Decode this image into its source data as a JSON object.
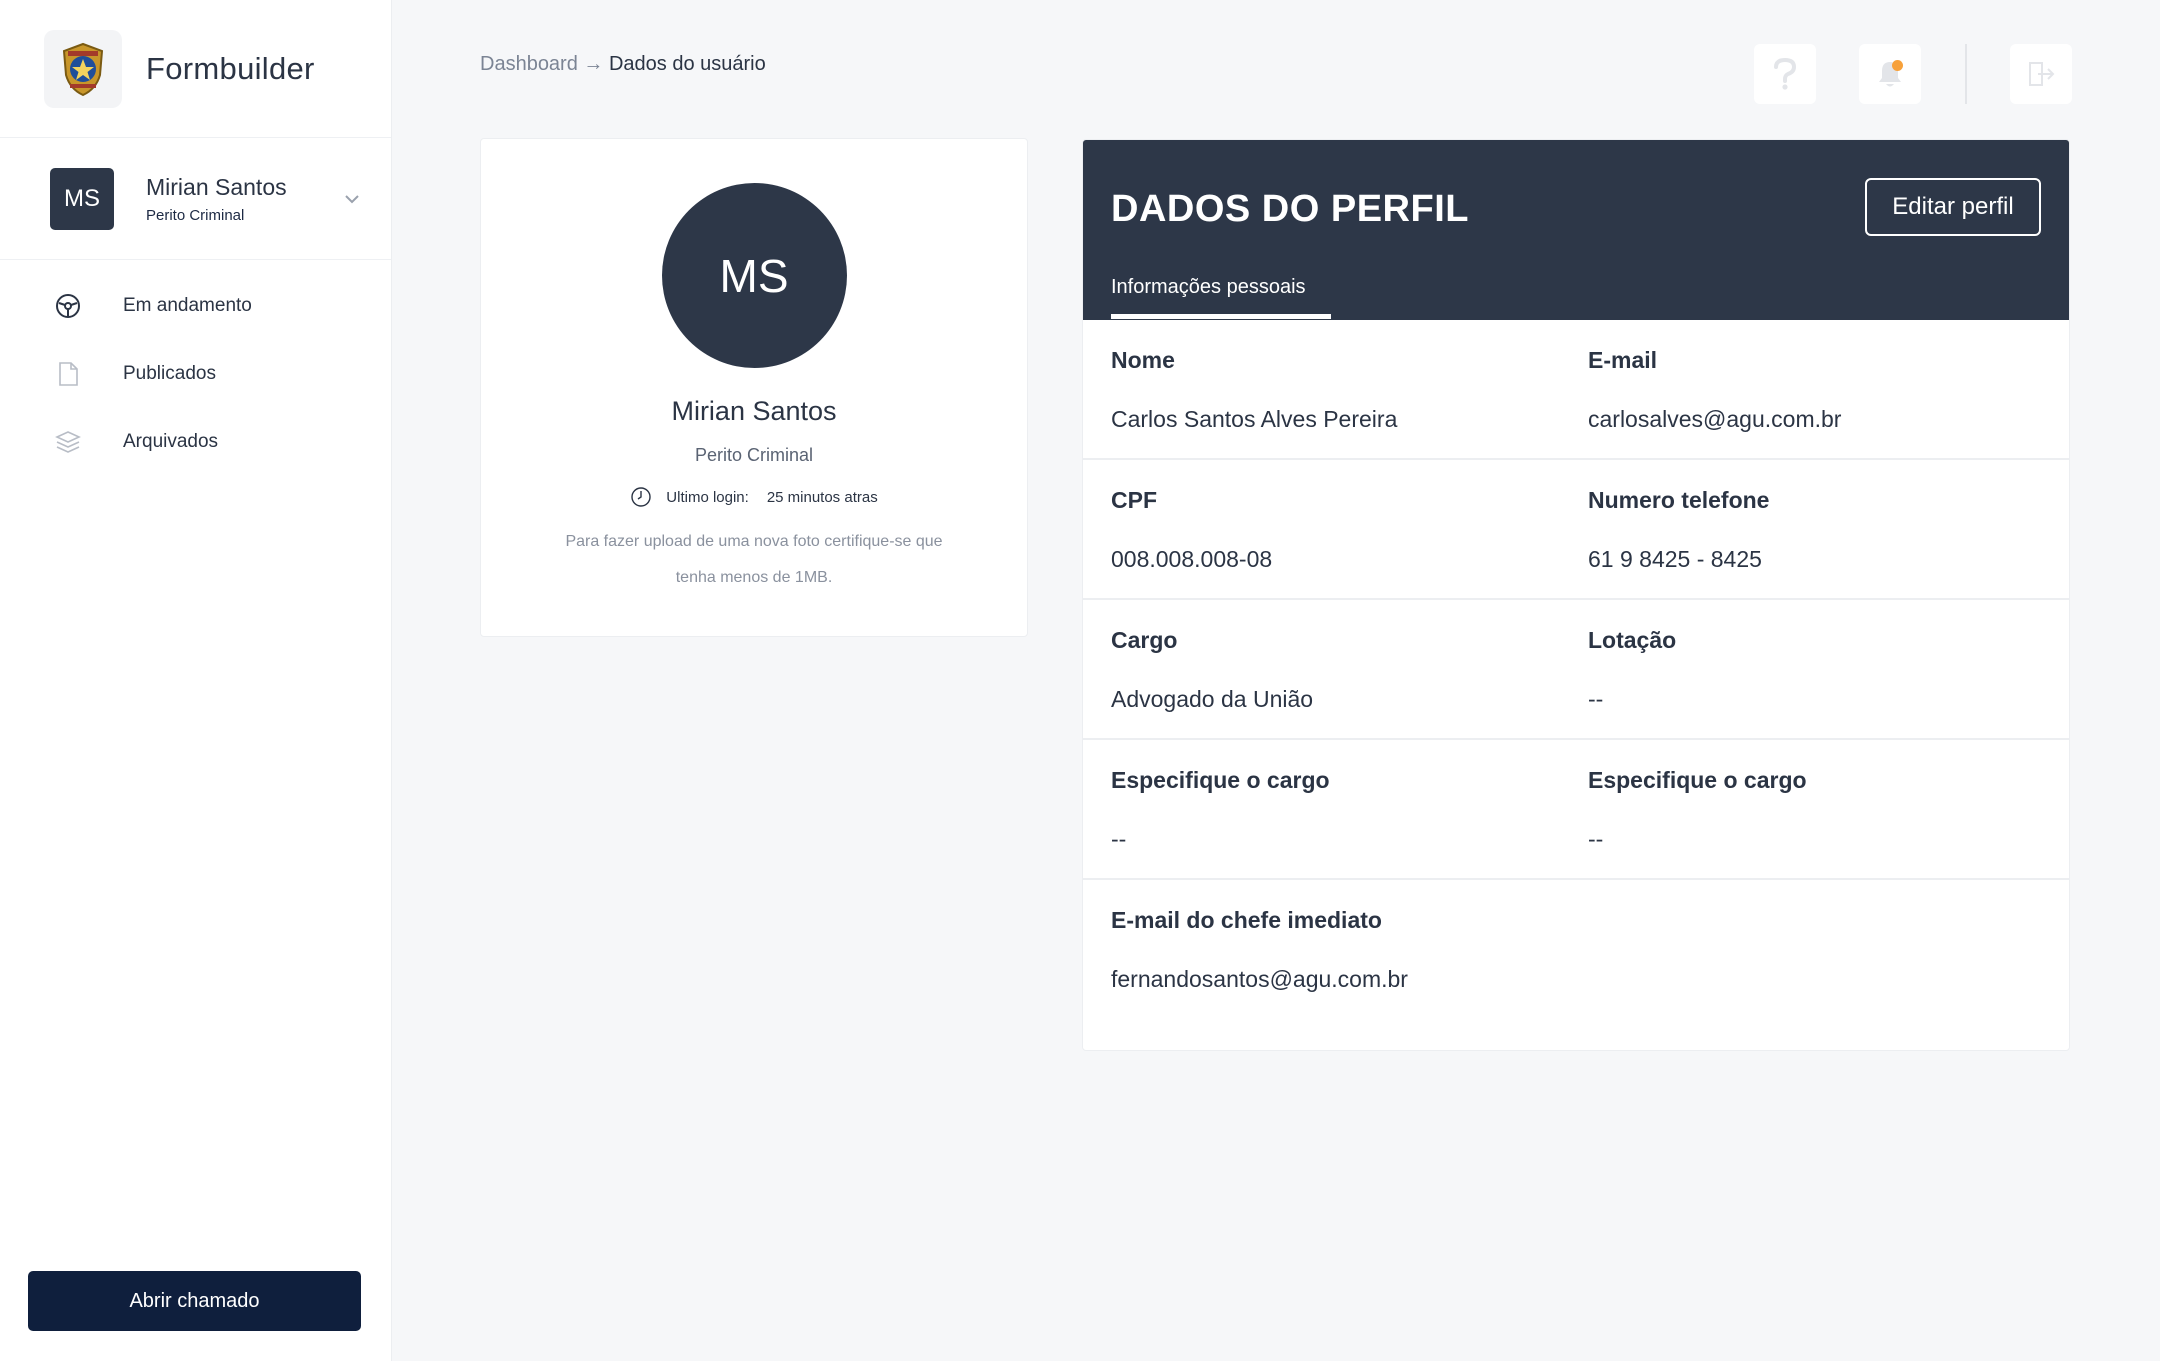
{
  "brand": {
    "name": "Formbuilder",
    "logo_icon": "police-badge-icon"
  },
  "user": {
    "initials": "MS",
    "name": "Mirian Santos",
    "role": "Perito Criminal"
  },
  "nav": {
    "items": [
      {
        "label": "Em andamento",
        "icon": "steering-icon"
      },
      {
        "label": "Publicados",
        "icon": "document-icon"
      },
      {
        "label": "Arquivados",
        "icon": "layers-icon"
      }
    ]
  },
  "actions": {
    "open_ticket": "Abrir chamado"
  },
  "breadcrumb": {
    "root": "Dashboard",
    "arrow": "→",
    "current": "Dados do usuário"
  },
  "topbar": {
    "help_icon": "help-icon",
    "notification_icon": "bell-icon",
    "logout_icon": "logout-icon"
  },
  "profile": {
    "initials": "MS",
    "name": "Mirian Santos",
    "role": "Perito Criminal",
    "last_login_label": "Ultimo login:",
    "last_login_value": "25 minutos atras",
    "upload_note": "Para fazer upload de uma nova foto certifique-se que tenha menos de 1MB."
  },
  "details": {
    "title": "DADOS DO PERFIL",
    "edit_label": "Editar perfil",
    "tab_label": "Informações pessoais",
    "fields": [
      {
        "label": "Nome",
        "value": "Carlos Santos Alves Pereira"
      },
      {
        "label": "E-mail",
        "value": "carlosalves@agu.com.br"
      },
      {
        "label": "CPF",
        "value": "008.008.008-08"
      },
      {
        "label": "Numero telefone",
        "value": "61 9 8425 - 8425"
      },
      {
        "label": "Cargo",
        "value": "Advogado da União"
      },
      {
        "label": "Lotação",
        "value": "--"
      },
      {
        "label": "Especifique o cargo",
        "value": "--"
      },
      {
        "label": "Especifique o cargo",
        "value": "--"
      },
      {
        "label": "E-mail do chefe imediato",
        "value": "fernandosantos@agu.com.br"
      }
    ]
  },
  "colors": {
    "primary": "#2d3748",
    "button_dark": "#0f1f3d",
    "notification_dot": "#f7a13b",
    "background": "#f6f7f9"
  }
}
